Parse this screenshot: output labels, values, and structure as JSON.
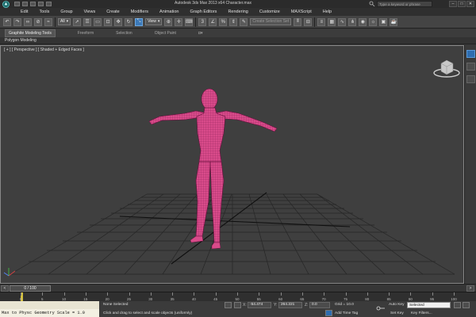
{
  "titlebar": {
    "title": "Autodesk 3ds Max 2013 x64    Character.max",
    "search_placeholder": "Type a keyword or phrase",
    "minimize": "–",
    "maximize": "□",
    "close": "✕"
  },
  "menu": [
    "Edit",
    "Tools",
    "Group",
    "Views",
    "Create",
    "Modifiers",
    "Animation",
    "Graph Editors",
    "Rendering",
    "Customize",
    "MAXScript",
    "Help"
  ],
  "toolbar": {
    "selection_filter": "All",
    "reference_coord": "View",
    "named_selection_set": "Create Selection Set"
  },
  "ribbon": {
    "tabs": [
      "Graphite Modeling Tools",
      "Freeform",
      "Selection",
      "Object Paint"
    ],
    "sub_label": "Polygon Modeling"
  },
  "viewport": {
    "label": "[ + ] [ Perspective ] [ Shaded + Edged Faces ]",
    "model_color": "#d94b8a"
  },
  "timeslider": {
    "frame_label": "0 / 100",
    "prev": "<",
    "next": ">"
  },
  "trackbar": {
    "ticks": [
      "0",
      "5",
      "10",
      "15",
      "20",
      "25",
      "30",
      "35",
      "40",
      "45",
      "50",
      "55",
      "60",
      "65",
      "70",
      "75",
      "80",
      "85",
      "90",
      "95",
      "100"
    ]
  },
  "status": {
    "maxscript": "Max to Physc Geometry Scale = 1.0",
    "selection": "None Selected",
    "prompt": "Click and drag to select and scale objects (uniformly)",
    "x_label": "X:",
    "x_value": "-54.474",
    "y_label": "Y:",
    "y_value": "264.221",
    "z_label": "Z:",
    "z_value": "0.0",
    "grid": "Grid = 10.0",
    "add_time_tag": "Add Time Tag",
    "auto_key": "Auto Key",
    "auto_key_value": "Selected",
    "set_key": "Set Key",
    "key_filters": "Key Filters..."
  }
}
